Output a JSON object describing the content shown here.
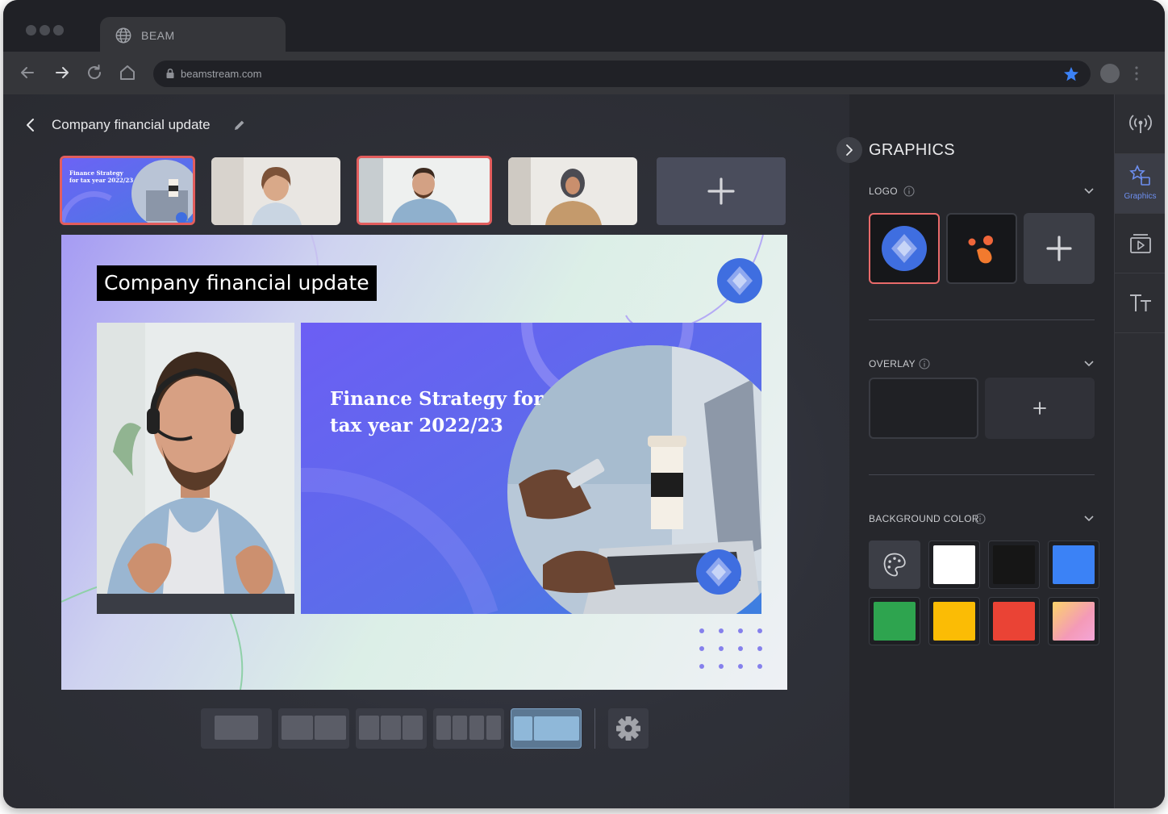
{
  "browser": {
    "tab_title": "BEAM",
    "url": "beamstream.com"
  },
  "editor": {
    "title": "Company financial update"
  },
  "stage": {
    "lower_third": "Company financial update",
    "slide_title": "Finance Strategy for tax year 2022/23",
    "thumb_slide_title": "Finance Strategy for tax year 2022/23"
  },
  "layouts": [
    "single",
    "two-split",
    "three-split",
    "four-split",
    "picture-in-picture"
  ],
  "panel": {
    "title": "GRAPHICS",
    "logo_label": "LOGO",
    "overlay_label": "OVERLAY",
    "background_label": "BACKGROUND COLOR",
    "swatches": [
      "#ffffff",
      "#161616",
      "#3b82f6",
      "#2ea44f",
      "#fbbc05",
      "#ea4335",
      "gradient"
    ]
  },
  "rail": {
    "graphics_label": "Graphics"
  },
  "colors": {
    "accent": "#3f6ee0",
    "selection": "#e25d5d"
  }
}
